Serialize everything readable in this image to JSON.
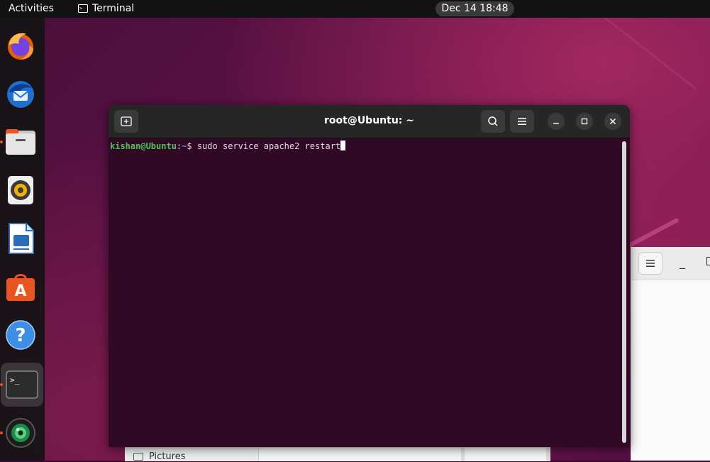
{
  "topbar": {
    "activities": "Activities",
    "app_name": "Terminal",
    "clock": "Dec 14  18:48"
  },
  "dock": {
    "items": [
      {
        "name": "Firefox",
        "icon": "firefox-icon"
      },
      {
        "name": "Thunderbird",
        "icon": "thunderbird-icon"
      },
      {
        "name": "Files",
        "icon": "files-icon"
      },
      {
        "name": "Rhythmbox",
        "icon": "rhythmbox-icon"
      },
      {
        "name": "LibreOffice Writer",
        "icon": "libreoffice-writer-icon"
      },
      {
        "name": "Ubuntu Software",
        "icon": "ubuntu-software-icon"
      },
      {
        "name": "Help",
        "icon": "help-icon"
      },
      {
        "name": "Terminal",
        "icon": "terminal-icon",
        "active": true
      },
      {
        "name": "Cheese",
        "icon": "webcam-icon"
      }
    ],
    "help_glyph": "?",
    "terminal_glyph": ">_",
    "software_glyph": "A"
  },
  "terminal": {
    "title": "root@Ubuntu: ~",
    "prompt_user": "kishan@Ubuntu",
    "prompt_sep": ":",
    "prompt_path": "~",
    "prompt_symbol": "$",
    "command": " sudo service apache2 restart"
  },
  "files_window": {
    "sidebar_item": "Pictures",
    "minimize_glyph": "_"
  },
  "colors": {
    "accent": "#e95420",
    "terminal_bg": "#300a24",
    "prompt_user": "#4cc35a",
    "prompt_path": "#5b8fd8"
  }
}
